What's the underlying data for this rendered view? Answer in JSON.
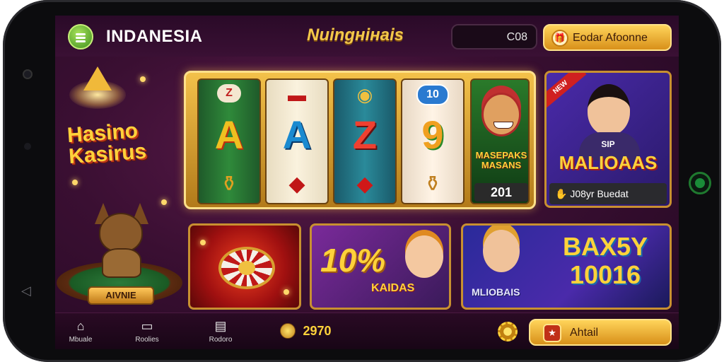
{
  "topbar": {
    "brand": "INDANESIA",
    "title": "Nuingнiнais",
    "balance": "C08",
    "cta_label": "Eodar Afoonne"
  },
  "left": {
    "logo_line1": "Hasino",
    "logo_line2": "Kasirus",
    "plaque": "AIVNIE"
  },
  "slot": {
    "reels": [
      {
        "top": "Z",
        "mid": "A",
        "bot": "⚱"
      },
      {
        "top": "▬",
        "mid": "A",
        "bot": "◆"
      },
      {
        "top": "◉",
        "mid": "Z",
        "bot": "◆"
      },
      {
        "top": "10",
        "mid": "9",
        "bot": "⚱"
      }
    ],
    "character_name": "MASEPAKS MASANS",
    "score": "201"
  },
  "promo": {
    "ribbon": "NEW",
    "sub": "SIP",
    "title": "MALIOAAS",
    "footer": "J08yr Buedat"
  },
  "tiles": {
    "bonus_value": "10%",
    "bonus_label": "KAIDAS",
    "boy_label": "MLIOBAIS",
    "promo_big": "BAX5Y 10016"
  },
  "bottombar": {
    "nav": [
      {
        "icon": "⌂",
        "label": "Mbuale"
      },
      {
        "icon": "▭",
        "label": "Roolies"
      },
      {
        "icon": "▤",
        "label": "Rodoro"
      }
    ],
    "coins": "2970",
    "cta_label": "Ahtail"
  },
  "colors": {
    "accent_gold": "#f3c84a",
    "bg_purple": "#3a0f32",
    "green": "#3f8f1f"
  }
}
